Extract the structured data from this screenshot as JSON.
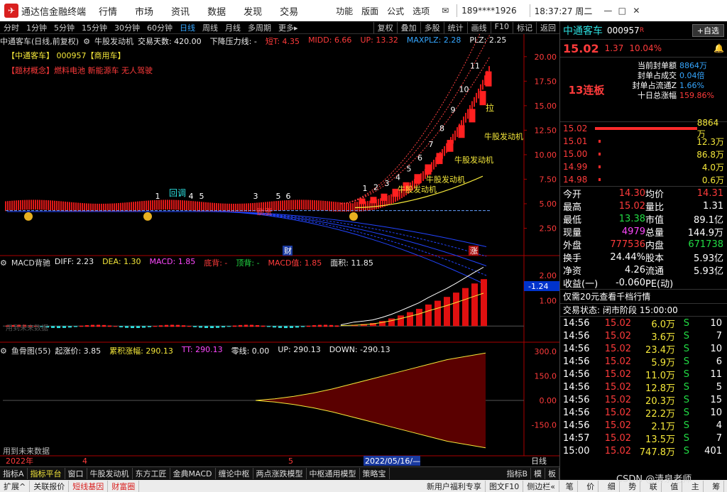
{
  "app": {
    "name": "通达信金融终端",
    "menus": [
      "行情",
      "市场",
      "资讯",
      "数据",
      "发现",
      "交易"
    ],
    "funcs": [
      "功能",
      "版面",
      "公式",
      "选项"
    ],
    "user": "189****1926",
    "time": "18:37:27 周二"
  },
  "toolbar": {
    "periods": [
      "分时",
      "1分钟",
      "5分钟",
      "15分钟",
      "30分钟",
      "60分钟",
      "日线",
      "周线",
      "月线",
      "多周期",
      "更多▸"
    ],
    "active_period": "日线",
    "tools": [
      "复权",
      "叠加",
      "多股",
      "统计",
      "画线",
      "F10",
      "标记",
      "返回"
    ]
  },
  "kline": {
    "title": "中通客车(日线,前复权)",
    "indicator": "牛股发动机",
    "params": [
      {
        "t": "交易天数: 420.00",
        "c": "white"
      },
      {
        "t": "下降压力线: -",
        "c": "white"
      },
      {
        "t": "短T: 4.35",
        "c": "red"
      },
      {
        "t": "MIDD: 6.66",
        "c": "red"
      },
      {
        "t": "UP: 13.32",
        "c": "red"
      },
      {
        "t": "MAXPLZ: 2.28",
        "c": "blue"
      },
      {
        "t": "PLZ: 2.25",
        "c": "white"
      }
    ],
    "tag1": "【中通客车】 000957【商用车】",
    "tag2": "【题材概念】燃料电池 新能源车 无人驾驶",
    "callback": "回调",
    "lock": "锁涨",
    "fa": "牛股发动机",
    "cai": "财",
    "zhang": "涨",
    "la": "拉"
  },
  "macd": {
    "title": "MACD背驰",
    "params": [
      {
        "t": "DIFF: 2.23",
        "c": "white"
      },
      {
        "t": "DEA: 1.30",
        "c": "yellow"
      },
      {
        "t": "MACD: 1.85",
        "c": "mag"
      },
      {
        "t": "底背: -",
        "c": "red"
      },
      {
        "t": "顶背: -",
        "c": "green"
      },
      {
        "t": "MACD值: 1.85",
        "c": "red"
      },
      {
        "t": "面积: 11.85",
        "c": "white"
      }
    ],
    "future": "用到未来数据"
  },
  "fish": {
    "title": "鱼骨图(55)",
    "params": [
      {
        "t": "起涨价: 3.85",
        "c": "white"
      },
      {
        "t": "累积涨幅: 290.13",
        "c": "yellow"
      },
      {
        "t": "TT: 290.13",
        "c": "mag"
      },
      {
        "t": "零线: 0.00",
        "c": "white"
      },
      {
        "t": "UP: 290.13",
        "c": "white"
      },
      {
        "t": "DOWN: -290.13",
        "c": "white"
      }
    ],
    "future": "用到未来数据"
  },
  "chart_data": [
    {
      "type": "candlestick",
      "name": "K线",
      "y_ticks": [
        "20.00",
        "17.50",
        "15.00",
        "12.50",
        "10.00",
        "7.50",
        "5.00",
        "2.50"
      ],
      "ylim": [
        0,
        21
      ],
      "current_label": "-1.24",
      "count_labels": [
        "1",
        "2",
        "3",
        "4",
        "5",
        "6",
        "7",
        "8",
        "9",
        "10",
        "11"
      ],
      "markers1": [
        "1",
        "4",
        "5"
      ],
      "markers2": [
        "3",
        "5",
        "6"
      ]
    },
    {
      "type": "bar",
      "name": "MACD",
      "y_ticks": [
        "2.00",
        "1.00"
      ],
      "ylim": [
        -0.3,
        2.5
      ],
      "values": [
        0.05,
        0.08,
        0.12,
        0.2,
        0.3,
        0.42,
        0.55,
        0.68,
        0.85,
        1.0,
        1.15,
        1.32,
        1.5,
        1.68,
        1.85
      ]
    },
    {
      "type": "area",
      "name": "鱼骨图",
      "y_ticks": [
        "300.0",
        "150.0",
        "0.00",
        "-150.0"
      ],
      "ylim": [
        -300,
        320
      ],
      "values": [
        0,
        10,
        25,
        45,
        70,
        100,
        130,
        160,
        190,
        220,
        250,
        270,
        290.13
      ]
    }
  ],
  "xaxis": {
    "labels": [
      "2022年",
      "4",
      "5",
      "2022/05/16/—"
    ],
    "right": "日线"
  },
  "quote": {
    "name": "中通客车",
    "code": "000957",
    "flag": "R",
    "group": "自选",
    "price": "15.02",
    "chg": "1.37",
    "pct": "10.04%",
    "streak": "13连板",
    "seal": [
      {
        "k": "当前封单额",
        "v": "8864万"
      },
      {
        "k": "封单占成交",
        "v": "0.04倍"
      },
      {
        "k": "封单占流通Z",
        "v": "1.66%"
      },
      {
        "k": "十日总涨幅",
        "v": "159.86%"
      }
    ],
    "book": [
      {
        "p": "15.02",
        "v": "8864万",
        "bar": 160
      },
      {
        "p": "15.01",
        "v": "12.3万",
        "bar": 3
      },
      {
        "p": "15.00",
        "v": "86.8万",
        "bar": 3
      },
      {
        "p": "14.99",
        "v": "4.0万",
        "bar": 3
      },
      {
        "p": "14.98",
        "v": "0.6万",
        "bar": 3
      }
    ],
    "stats": [
      [
        "今开",
        "14.30",
        "red",
        "均价",
        "14.31",
        "red"
      ],
      [
        "最高",
        "15.02",
        "red",
        "量比",
        "1.31",
        "white"
      ],
      [
        "最低",
        "13.38",
        "green",
        "市值",
        "89.1亿",
        "white"
      ],
      [
        "现量",
        "4979",
        "mag",
        "总量",
        "144.9万",
        "white"
      ],
      [
        "外盘",
        "777536",
        "red",
        "内盘",
        "671738",
        "green"
      ],
      [
        "换手",
        "24.44%",
        "white",
        "股本",
        "5.93亿",
        "white"
      ],
      [
        "净资",
        "4.26",
        "white",
        "流通",
        "5.93亿",
        "white"
      ],
      [
        "收益(一)",
        "-0.060",
        "white",
        "PE(动)",
        "",
        ""
      ]
    ],
    "promo": "仅需20元查看千档行情",
    "status_k": "交易状态:",
    "status_v": "闭市阶段 15:00:00",
    "ticks": [
      [
        "14:56",
        "15.02",
        "6.0万",
        "S",
        "10"
      ],
      [
        "14:56",
        "15.02",
        "3.6万",
        "S",
        "7"
      ],
      [
        "14:56",
        "15.02",
        "23.4万",
        "S",
        "10"
      ],
      [
        "14:56",
        "15.02",
        "5.9万",
        "S",
        "6"
      ],
      [
        "14:56",
        "15.02",
        "11.0万",
        "S",
        "11"
      ],
      [
        "14:56",
        "15.02",
        "12.8万",
        "S",
        "5"
      ],
      [
        "14:56",
        "15.02",
        "20.3万",
        "S",
        "15"
      ],
      [
        "14:56",
        "15.02",
        "22.2万",
        "S",
        "10"
      ],
      [
        "14:56",
        "15.02",
        "2.1万",
        "S",
        "4"
      ],
      [
        "14:57",
        "15.02",
        "13.5万",
        "S",
        "7"
      ],
      [
        "15:00",
        "15.02",
        "747.8万",
        "S",
        "401"
      ]
    ]
  },
  "bottom_tabs": [
    "指标A",
    "指标平台",
    "窗口",
    "牛股发动机",
    "东方工匠",
    "金典MACD",
    "缠论中枢",
    "两点涨跌模型",
    "中枢通用模型",
    "策略宝"
  ],
  "bottom_active": "指标平台",
  "bottom_right": [
    "指标B",
    "模",
    "板"
  ],
  "status": [
    "扩展^",
    "关联报价",
    "短线基因",
    "财富圈"
  ],
  "status_right": [
    "新用户福利专享",
    "图文F10",
    "侧边栏«"
  ],
  "sidebar_tabs": [
    "笔",
    "价",
    "细",
    "势",
    "联",
    "值",
    "主",
    "筹"
  ],
  "watermark": "CSDN @清泉老师"
}
